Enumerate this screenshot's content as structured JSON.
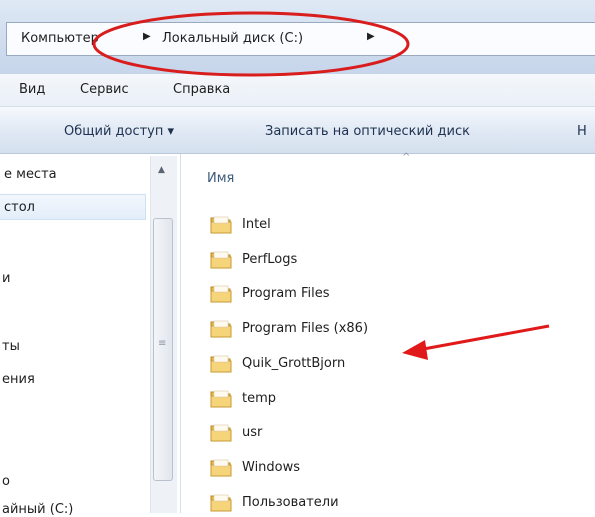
{
  "address_bar": {
    "crumbs": [
      "Компьютер",
      "Локальный диск (C:)"
    ],
    "separator": "▶"
  },
  "menu": {
    "items": [
      "Вид",
      "Сервис",
      "Справка"
    ]
  },
  "commands": {
    "share_label": "Общий доступ ▾",
    "burn_label": "Записать на оптический диск",
    "overflow_label": "Н"
  },
  "nav": {
    "items": [
      "е места",
      "стол",
      "и",
      "ты",
      "ения",
      "о",
      "айный (С:)"
    ]
  },
  "file_list": {
    "column_header": "Имя",
    "files": [
      {
        "name": "Intel",
        "icon": "folder-icon"
      },
      {
        "name": "PerfLogs",
        "icon": "folder-icon"
      },
      {
        "name": "Program Files",
        "icon": "folder-icon"
      },
      {
        "name": "Program Files (x86)",
        "icon": "folder-icon"
      },
      {
        "name": "Quik_GrottBjorn",
        "icon": "folder-icon"
      },
      {
        "name": "temp",
        "icon": "folder-icon"
      },
      {
        "name": "usr",
        "icon": "folder-icon"
      },
      {
        "name": "Windows",
        "icon": "folder-icon"
      },
      {
        "name": "Пользователи",
        "icon": "folder-icon"
      }
    ]
  },
  "annotations": {
    "ellipse_color": "#d91c1c",
    "arrow_color": "#e0191b"
  }
}
